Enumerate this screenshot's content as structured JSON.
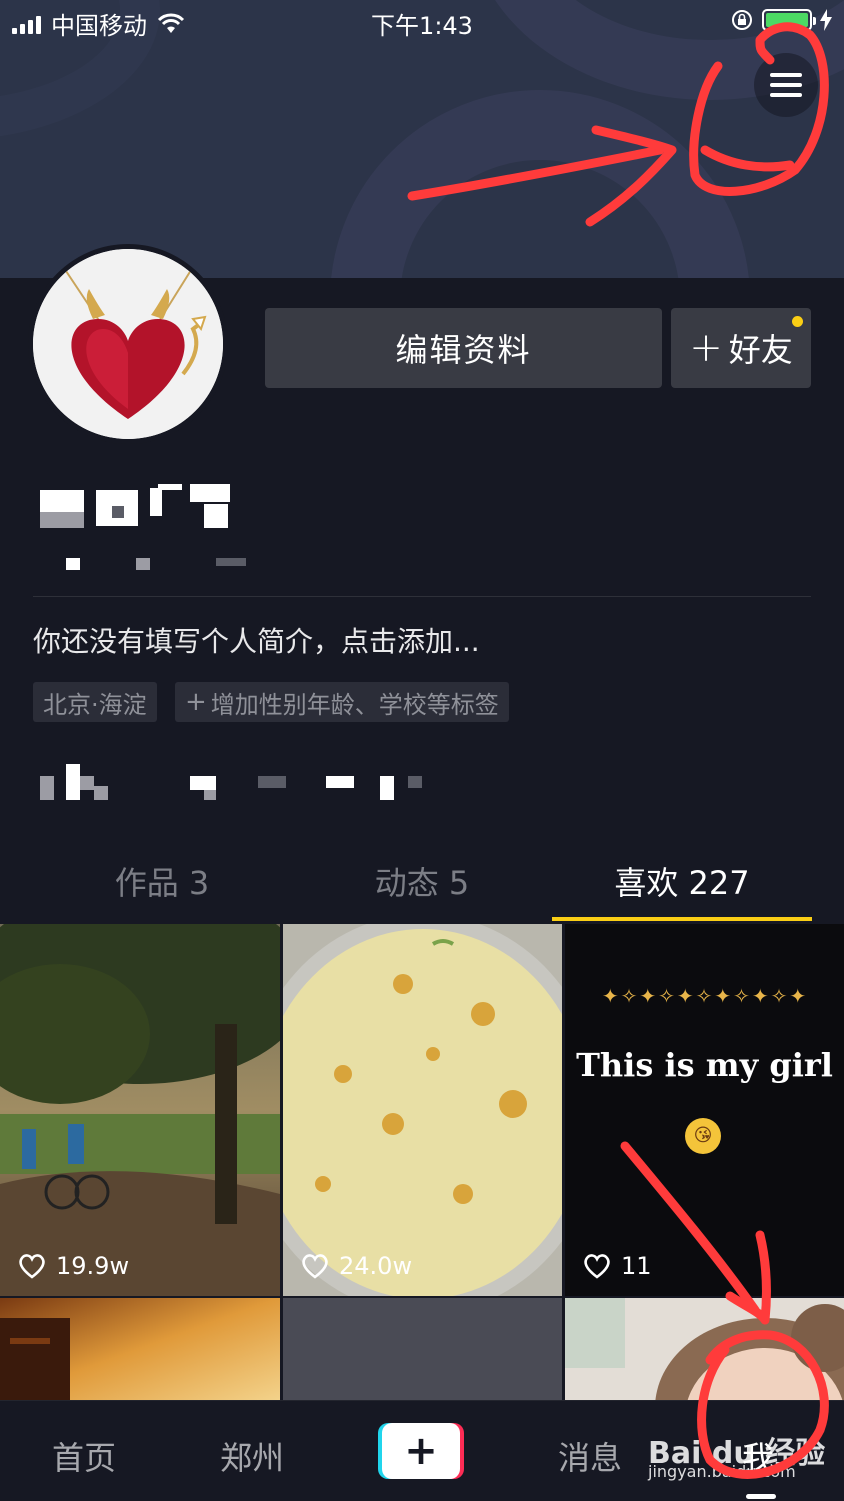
{
  "status_bar": {
    "carrier": "中国移动",
    "time": "下午1:43"
  },
  "profile": {
    "edit_label": "编辑资料",
    "add_friend_label": "好友",
    "bio": "你还没有填写个人简介，点击添加...",
    "tags": [
      "北京·海淀",
      "增加性别年龄、学校等标签"
    ]
  },
  "tabs": [
    {
      "label": "作品 3"
    },
    {
      "label": "动态 5"
    },
    {
      "label": "喜欢 227"
    }
  ],
  "videos": [
    {
      "likes": "19.9w"
    },
    {
      "likes": "24.0w"
    },
    {
      "likes": "11",
      "caption": "This is my girl"
    }
  ],
  "bottom_nav": {
    "items": [
      "首页",
      "郑州",
      "消息",
      "我"
    ]
  },
  "watermark": {
    "brand": "Bai du 经验",
    "url": "jingyan.baidu.com"
  },
  "colors": {
    "background": "#161823",
    "accent": "#face15",
    "button": "#393b44"
  }
}
